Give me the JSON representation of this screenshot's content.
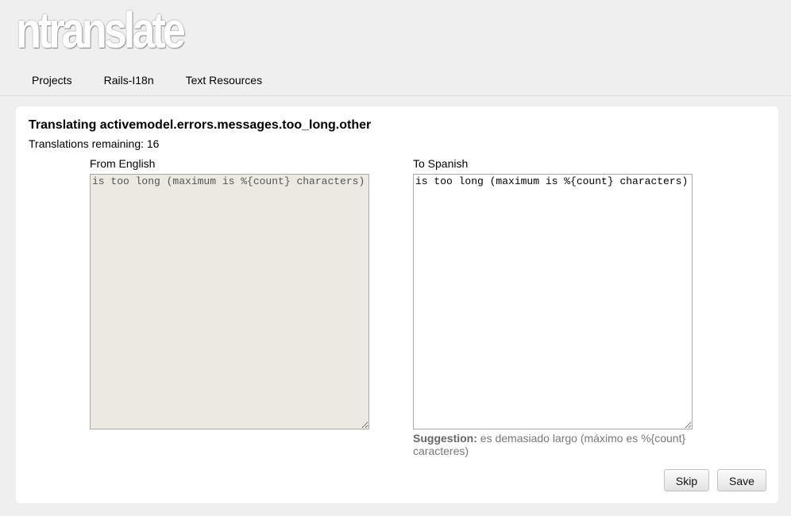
{
  "app": {
    "logo_text": "ntranslate"
  },
  "nav": {
    "items": [
      {
        "label": "Projects"
      },
      {
        "label": "Rails-I18n"
      },
      {
        "label": "Text Resources"
      }
    ]
  },
  "translation": {
    "heading": "Translating activemodel.errors.messages.too_long.other",
    "remaining": "Translations remaining: 16",
    "source": {
      "label": "From English",
      "value": "is too long (maximum is %{count} characters)"
    },
    "target": {
      "label": "To Spanish",
      "value": "is too long (maximum is %{count} characters)"
    },
    "suggestion": {
      "prefix": "Suggestion:",
      "text": "es demasiado largo (máximo es %{count} caracteres)"
    }
  },
  "actions": {
    "skip_label": "Skip",
    "save_label": "Save"
  },
  "colors": {
    "page_background": "#efefef",
    "panel_background": "#ffffff",
    "readonly_field_background": "#ebe9e1",
    "suggestion_text": "#777777"
  }
}
